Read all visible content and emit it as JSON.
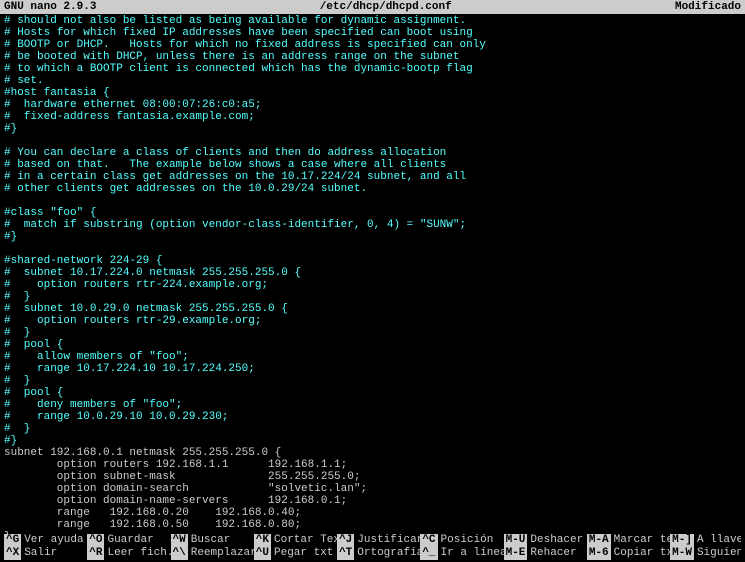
{
  "titlebar": {
    "app": "GNU nano 2.9.3",
    "file": "/etc/dhcp/dhcpd.conf",
    "status": "Modificado"
  },
  "lines": [
    {
      "c": "cyan",
      "t": "# should not also be listed as being available for dynamic assignment."
    },
    {
      "c": "cyan",
      "t": "# Hosts for which fixed IP addresses have been specified can boot using"
    },
    {
      "c": "cyan",
      "t": "# BOOTP or DHCP.   Hosts for which no fixed address is specified can only"
    },
    {
      "c": "cyan",
      "t": "# be booted with DHCP, unless there is an address range on the subnet"
    },
    {
      "c": "cyan",
      "t": "# to which a BOOTP client is connected which has the dynamic-bootp flag"
    },
    {
      "c": "cyan",
      "t": "# set."
    },
    {
      "c": "cyan",
      "t": "#host fantasia {"
    },
    {
      "c": "cyan",
      "t": "#  hardware ethernet 08:00:07:26:c0:a5;"
    },
    {
      "c": "cyan",
      "t": "#  fixed-address fantasia.example.com;"
    },
    {
      "c": "cyan",
      "t": "#}"
    },
    {
      "c": "cyan",
      "t": ""
    },
    {
      "c": "cyan",
      "t": "# You can declare a class of clients and then do address allocation"
    },
    {
      "c": "cyan",
      "t": "# based on that.   The example below shows a case where all clients"
    },
    {
      "c": "cyan",
      "t": "# in a certain class get addresses on the 10.17.224/24 subnet, and all"
    },
    {
      "c": "cyan",
      "t": "# other clients get addresses on the 10.0.29/24 subnet."
    },
    {
      "c": "cyan",
      "t": ""
    },
    {
      "c": "cyan",
      "t": "#class \"foo\" {"
    },
    {
      "c": "cyan",
      "t": "#  match if substring (option vendor-class-identifier, 0, 4) = \"SUNW\";"
    },
    {
      "c": "cyan",
      "t": "#}"
    },
    {
      "c": "cyan",
      "t": ""
    },
    {
      "c": "cyan",
      "t": "#shared-network 224-29 {"
    },
    {
      "c": "cyan",
      "t": "#  subnet 10.17.224.0 netmask 255.255.255.0 {"
    },
    {
      "c": "cyan",
      "t": "#    option routers rtr-224.example.org;"
    },
    {
      "c": "cyan",
      "t": "#  }"
    },
    {
      "c": "cyan",
      "t": "#  subnet 10.0.29.0 netmask 255.255.255.0 {"
    },
    {
      "c": "cyan",
      "t": "#    option routers rtr-29.example.org;"
    },
    {
      "c": "cyan",
      "t": "#  }"
    },
    {
      "c": "cyan",
      "t": "#  pool {"
    },
    {
      "c": "cyan",
      "t": "#    allow members of \"foo\";"
    },
    {
      "c": "cyan",
      "t": "#    range 10.17.224.10 10.17.224.250;"
    },
    {
      "c": "cyan",
      "t": "#  }"
    },
    {
      "c": "cyan",
      "t": "#  pool {"
    },
    {
      "c": "cyan",
      "t": "#    deny members of \"foo\";"
    },
    {
      "c": "cyan",
      "t": "#    range 10.0.29.10 10.0.29.230;"
    },
    {
      "c": "cyan",
      "t": "#  }"
    },
    {
      "c": "cyan",
      "t": "#}"
    },
    {
      "c": "white",
      "t": "subnet 192.168.0.1 netmask 255.255.255.0 {"
    },
    {
      "c": "white",
      "t": "        option routers 192.168.1.1      192.168.1.1;"
    },
    {
      "c": "white",
      "t": "        option subnet-mask              255.255.255.0;"
    },
    {
      "c": "white",
      "t": "        option domain-search            \"solvetic.lan\";"
    },
    {
      "c": "white",
      "t": "        option domain-name-servers      192.168.0.1;"
    },
    {
      "c": "white",
      "t": "        range   192.168.0.20    192.168.0.40;"
    },
    {
      "c": "white",
      "t": "        range   192.168.0.50    192.168.0.80;"
    },
    {
      "c": "white",
      "t": "}"
    }
  ],
  "shortcuts_row1": [
    {
      "k": "^G",
      "l": "Ver ayuda"
    },
    {
      "k": "^O",
      "l": "Guardar"
    },
    {
      "k": "^W",
      "l": "Buscar"
    },
    {
      "k": "^K",
      "l": "Cortar Texto"
    },
    {
      "k": "^J",
      "l": "Justificar"
    },
    {
      "k": "^C",
      "l": "Posición"
    },
    {
      "k": "M-U",
      "l": "Deshacer"
    },
    {
      "k": "M-A",
      "l": "Marcar texto"
    }
  ],
  "shortcuts_row2": [
    {
      "k": "^X",
      "l": "Salir"
    },
    {
      "k": "^R",
      "l": "Leer fich."
    },
    {
      "k": "^\\",
      "l": "Reemplazar"
    },
    {
      "k": "^U",
      "l": "Pegar txt"
    },
    {
      "k": "^T",
      "l": "Ortografía"
    },
    {
      "k": "^_",
      "l": "Ir a línea"
    },
    {
      "k": "M-E",
      "l": "Rehacer"
    },
    {
      "k": "M-6",
      "l": "Copiar txt"
    }
  ],
  "shortcuts_extra1": {
    "k": "M-]",
    "l": "A llave"
  },
  "shortcuts_extra2": {
    "k": "M-W",
    "l": "Siguiente"
  }
}
